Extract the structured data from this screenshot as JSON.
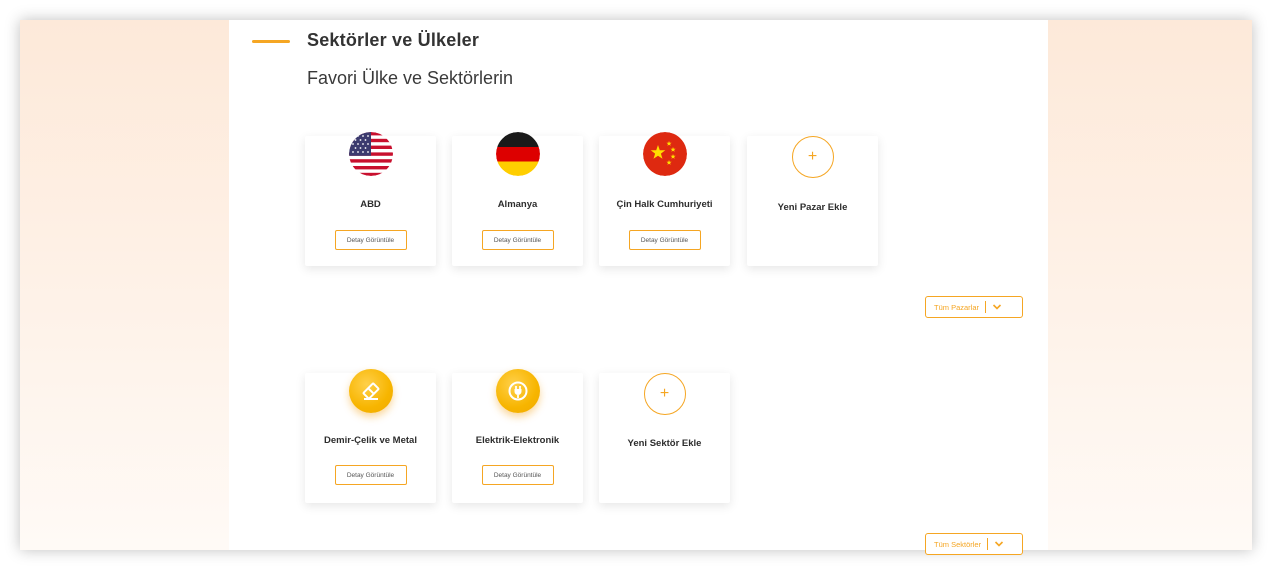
{
  "section": {
    "title": "Sektörler ve Ülkeler",
    "subtitle": "Favori Ülke ve Sektörlerin"
  },
  "markets": [
    {
      "name": "ABD",
      "icon": "usa-flag-icon",
      "button": "Detay Görüntüle"
    },
    {
      "name": "Almanya",
      "icon": "germany-flag-icon",
      "button": "Detay Görüntüle"
    },
    {
      "name": "Çin Halk Cumhuriyeti",
      "icon": "china-flag-icon",
      "button": "Detay Görüntüle"
    }
  ],
  "add_market": {
    "label": "Yeni Pazar Ekle",
    "icon": "plus-icon"
  },
  "all_markets_button": "Tüm Pazarlar",
  "sectors": [
    {
      "name": "Demir-Çelik ve Metal",
      "icon": "steel-icon",
      "button": "Detay Görüntüle"
    },
    {
      "name": "Elektrik-Elektronik",
      "icon": "plug-icon",
      "button": "Detay Görüntüle"
    }
  ],
  "add_sector": {
    "label": "Yeni Sektör Ekle",
    "icon": "plus-icon"
  },
  "all_sectors_button": "Tüm Sektörler",
  "colors": {
    "accent": "#f5a623",
    "text": "#2d2d2d"
  }
}
